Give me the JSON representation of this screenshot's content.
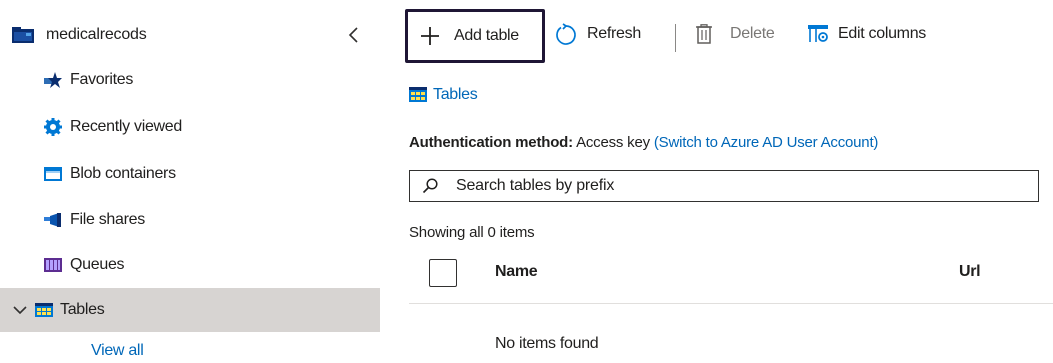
{
  "sidebar": {
    "account_name": "medicalrecods",
    "items": [
      {
        "label": "Favorites"
      },
      {
        "label": "Recently viewed"
      },
      {
        "label": "Blob containers"
      },
      {
        "label": "File shares"
      },
      {
        "label": "Queues"
      },
      {
        "label": "Tables",
        "selected": true
      }
    ],
    "view_all": "View all"
  },
  "toolbar": {
    "add_table": "Add table",
    "refresh": "Refresh",
    "delete": "Delete",
    "edit_columns": "Edit columns"
  },
  "breadcrumb": {
    "label": "Tables"
  },
  "auth": {
    "label": "Authentication method:",
    "method": "Access key",
    "switch_link": "(Switch to Azure AD User Account)"
  },
  "search": {
    "placeholder": "Search tables by prefix",
    "value": ""
  },
  "list": {
    "count_text": "Showing all 0 items",
    "columns": [
      "Name",
      "Url"
    ],
    "empty_text": "No items found"
  },
  "colors": {
    "accent": "#0067b8",
    "selected_bg": "#d7d4d2",
    "highlight_border": "#1f1635"
  }
}
